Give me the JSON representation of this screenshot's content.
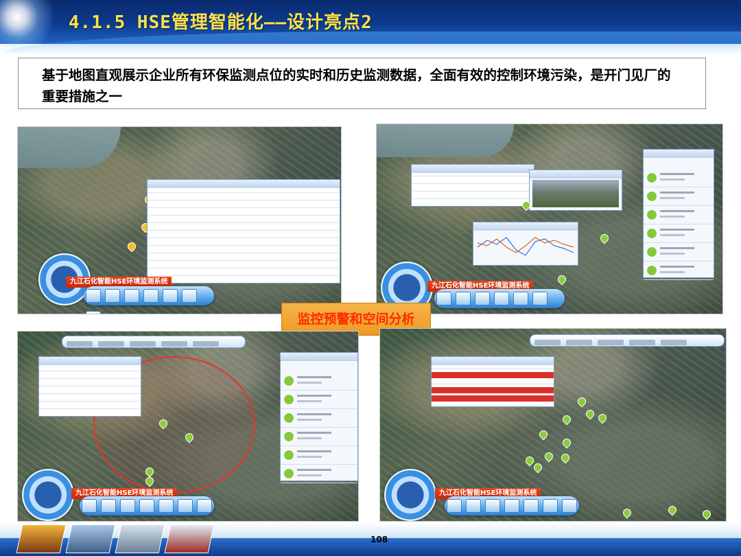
{
  "header": {
    "title": "4.1.5 HSE管理智能化——设计亮点2"
  },
  "description": {
    "text": "基于地图直观展示企业所有环保监测点位的实时和历史监测数据，全面有效的控制环境污染，是开门见厂的重要措施之一"
  },
  "center_label": {
    "text": "监控预警和空间分析"
  },
  "screenshots": [
    {
      "system_name": "九江石化智能HSE环境监测系统"
    },
    {
      "system_name": "九江石化智能HSE环境监测系统"
    },
    {
      "system_name": "九江石化智能HSE环境监测系统"
    },
    {
      "system_name": "九江石化智能HSE环境监测系统"
    }
  ],
  "footer": {
    "page_number": "108"
  },
  "colors": {
    "title": "#ffe24a",
    "label_text": "#ff2a00",
    "label_bg": "#ee9a22",
    "header_bg": "#0c3b8f"
  }
}
